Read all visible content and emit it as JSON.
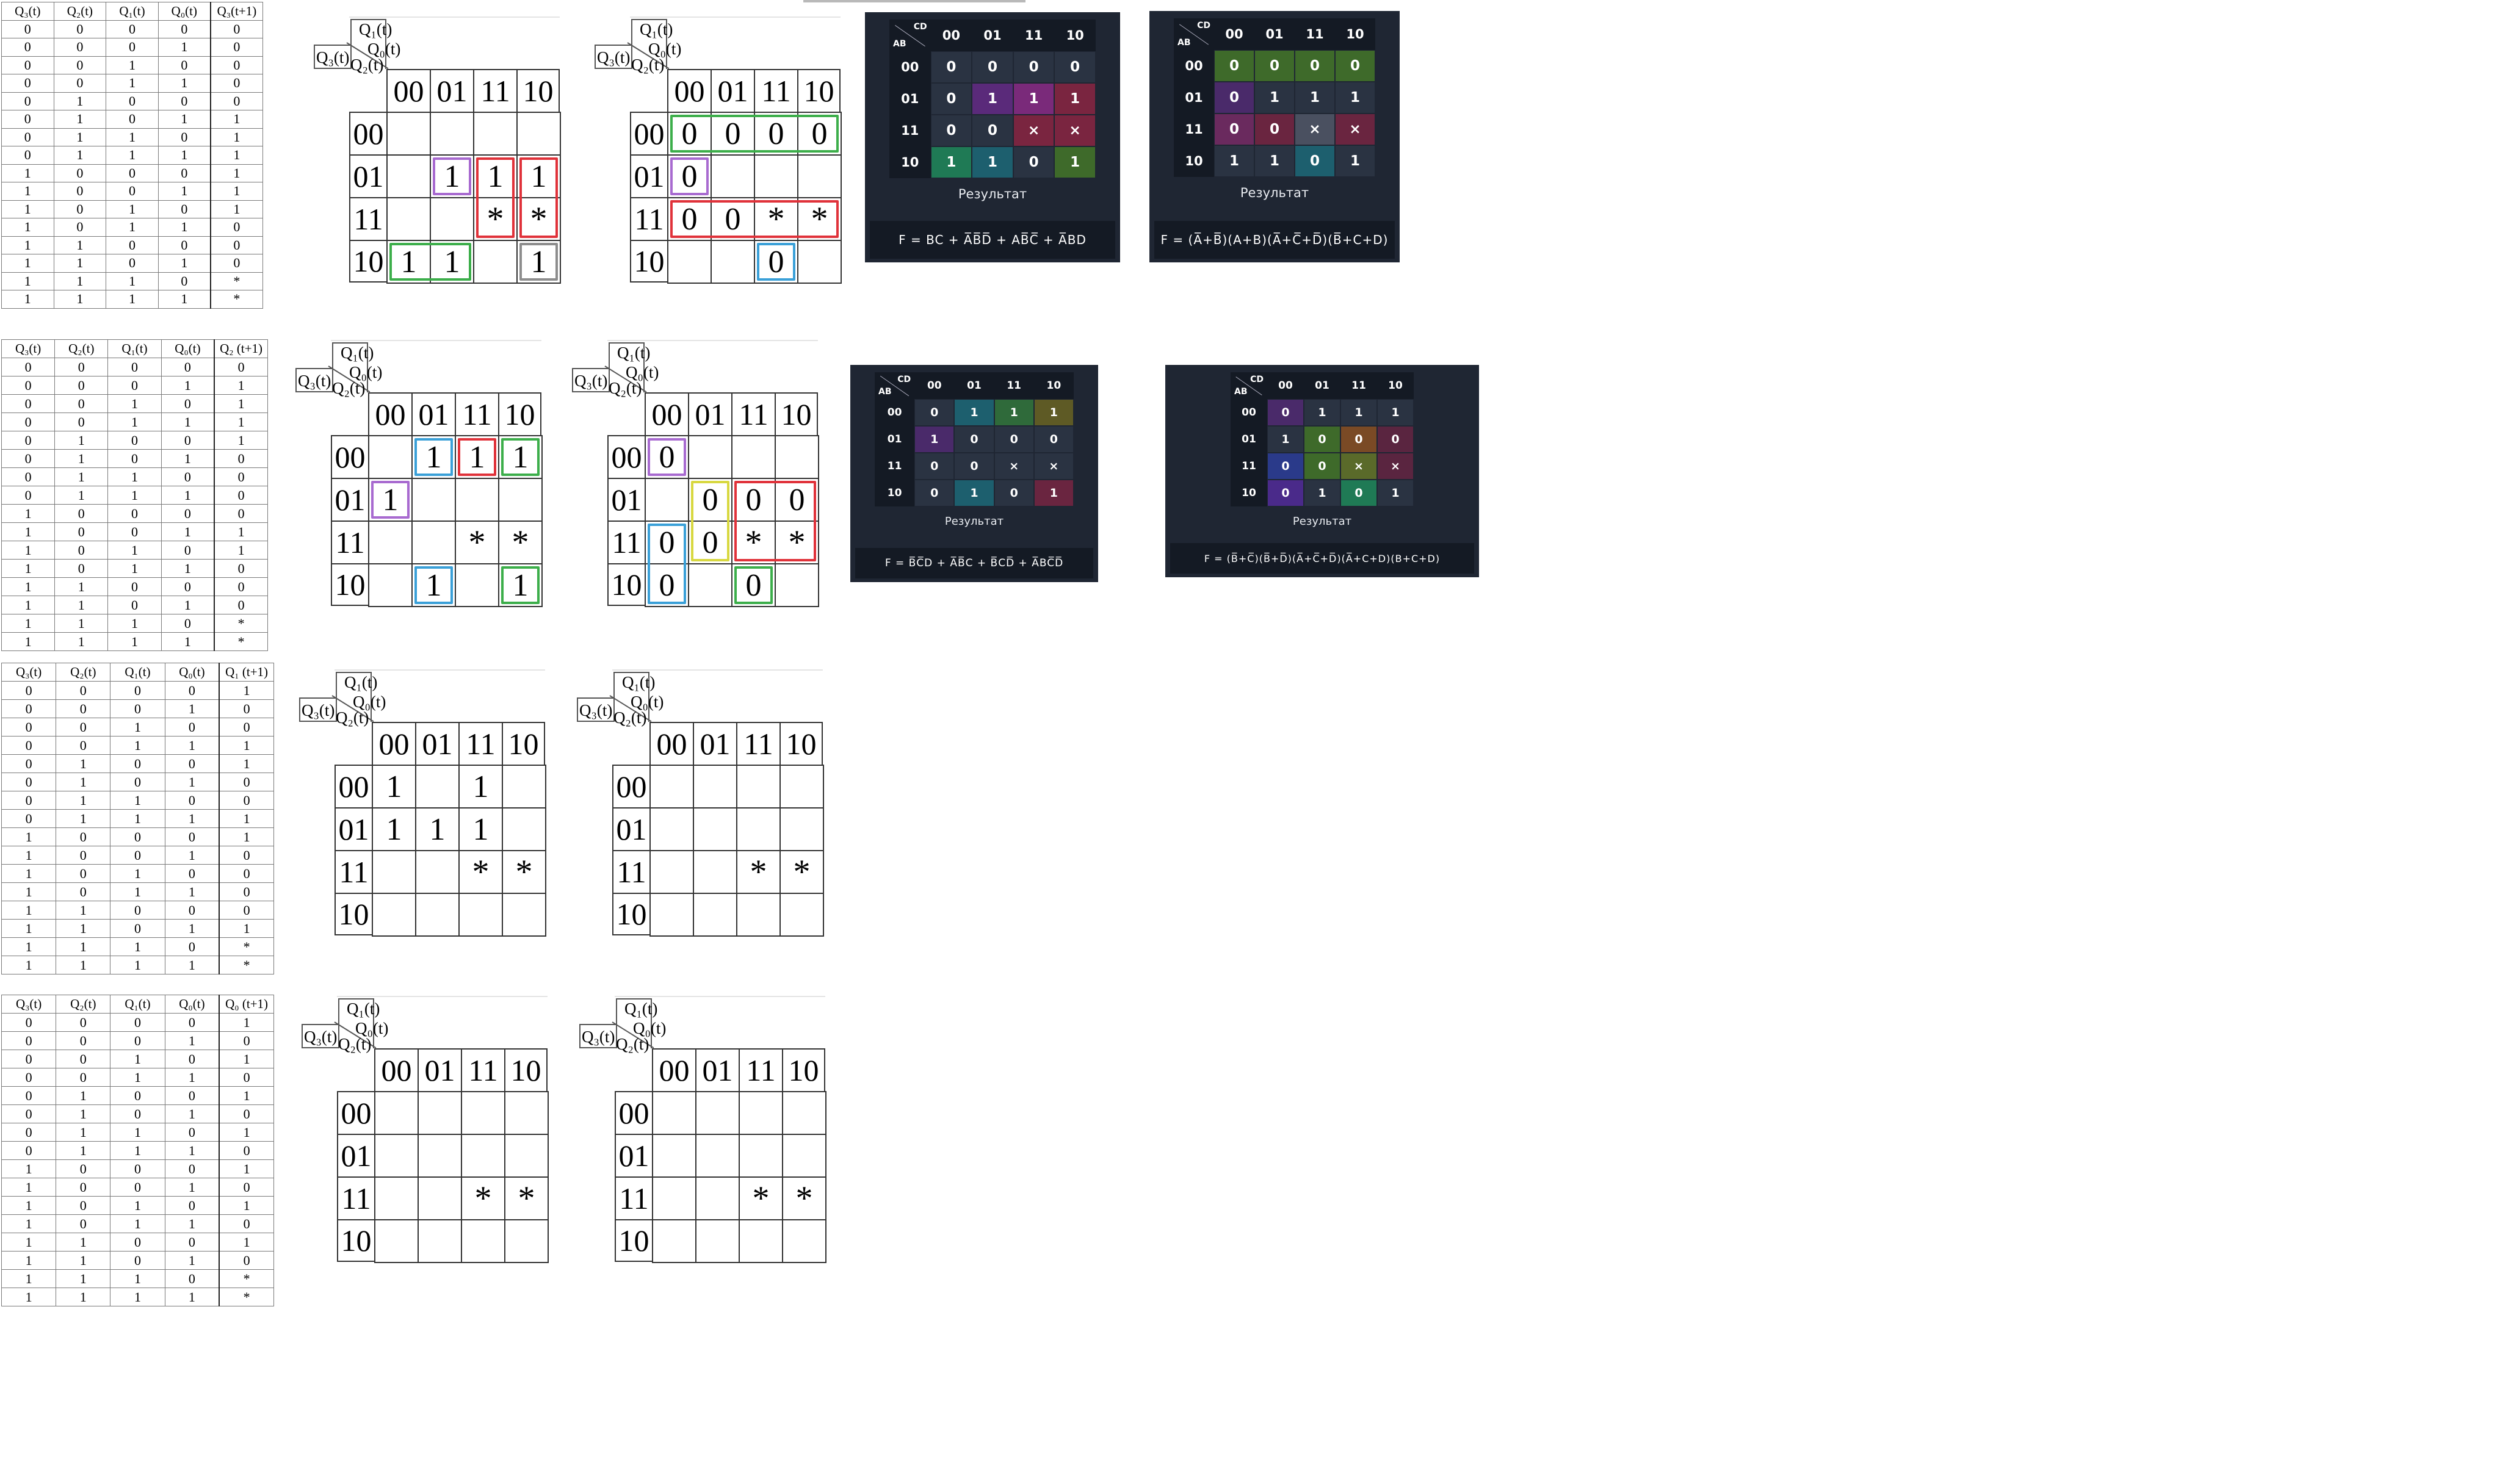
{
  "truth_tables": [
    {
      "headers": [
        "Q₃(t)",
        "Q₂(t)",
        "Q₁(t)",
        "Q₀(t)",
        "Q₃(t+1)"
      ],
      "rows": [
        [
          "0",
          "0",
          "0",
          "0",
          "0"
        ],
        [
          "0",
          "0",
          "0",
          "1",
          "0"
        ],
        [
          "0",
          "0",
          "1",
          "0",
          "0"
        ],
        [
          "0",
          "0",
          "1",
          "1",
          "0"
        ],
        [
          "0",
          "1",
          "0",
          "0",
          "0"
        ],
        [
          "0",
          "1",
          "0",
          "1",
          "1"
        ],
        [
          "0",
          "1",
          "1",
          "0",
          "1"
        ],
        [
          "0",
          "1",
          "1",
          "1",
          "1"
        ],
        [
          "1",
          "0",
          "0",
          "0",
          "1"
        ],
        [
          "1",
          "0",
          "0",
          "1",
          "1"
        ],
        [
          "1",
          "0",
          "1",
          "0",
          "1"
        ],
        [
          "1",
          "0",
          "1",
          "1",
          "0"
        ],
        [
          "1",
          "1",
          "0",
          "0",
          "0"
        ],
        [
          "1",
          "1",
          "0",
          "1",
          "0"
        ],
        [
          "1",
          "1",
          "1",
          "0",
          "*"
        ],
        [
          "1",
          "1",
          "1",
          "1",
          "*"
        ]
      ]
    },
    {
      "headers": [
        "Q₃(t)",
        "Q₂(t)",
        "Q₁(t)",
        "Q₀(t)",
        "Q₂ (t+1)"
      ],
      "rows": [
        [
          "0",
          "0",
          "0",
          "0",
          "0"
        ],
        [
          "0",
          "0",
          "0",
          "1",
          "1"
        ],
        [
          "0",
          "0",
          "1",
          "0",
          "1"
        ],
        [
          "0",
          "0",
          "1",
          "1",
          "1"
        ],
        [
          "0",
          "1",
          "0",
          "0",
          "1"
        ],
        [
          "0",
          "1",
          "0",
          "1",
          "0"
        ],
        [
          "0",
          "1",
          "1",
          "0",
          "0"
        ],
        [
          "0",
          "1",
          "1",
          "1",
          "0"
        ],
        [
          "1",
          "0",
          "0",
          "0",
          "0"
        ],
        [
          "1",
          "0",
          "0",
          "1",
          "1"
        ],
        [
          "1",
          "0",
          "1",
          "0",
          "1"
        ],
        [
          "1",
          "0",
          "1",
          "1",
          "0"
        ],
        [
          "1",
          "1",
          "0",
          "0",
          "0"
        ],
        [
          "1",
          "1",
          "0",
          "1",
          "0"
        ],
        [
          "1",
          "1",
          "1",
          "0",
          "*"
        ],
        [
          "1",
          "1",
          "1",
          "1",
          "*"
        ]
      ]
    },
    {
      "headers": [
        "Q₃(t)",
        "Q₂(t)",
        "Q₁(t)",
        "Q₀(t)",
        "Q₁ (t+1)"
      ],
      "rows": [
        [
          "0",
          "0",
          "0",
          "0",
          "1"
        ],
        [
          "0",
          "0",
          "0",
          "1",
          "0"
        ],
        [
          "0",
          "0",
          "1",
          "0",
          "0"
        ],
        [
          "0",
          "0",
          "1",
          "1",
          "1"
        ],
        [
          "0",
          "1",
          "0",
          "0",
          "1"
        ],
        [
          "0",
          "1",
          "0",
          "1",
          "0"
        ],
        [
          "0",
          "1",
          "1",
          "0",
          "0"
        ],
        [
          "0",
          "1",
          "1",
          "1",
          "1"
        ],
        [
          "1",
          "0",
          "0",
          "0",
          "1"
        ],
        [
          "1",
          "0",
          "0",
          "1",
          "0"
        ],
        [
          "1",
          "0",
          "1",
          "0",
          "0"
        ],
        [
          "1",
          "0",
          "1",
          "1",
          "0"
        ],
        [
          "1",
          "1",
          "0",
          "0",
          "0"
        ],
        [
          "1",
          "1",
          "0",
          "1",
          "1"
        ],
        [
          "1",
          "1",
          "1",
          "0",
          "*"
        ],
        [
          "1",
          "1",
          "1",
          "1",
          "*"
        ]
      ]
    },
    {
      "headers": [
        "Q₃(t)",
        "Q₂(t)",
        "Q₁(t)",
        "Q₀(t)",
        "Q₀ (t+1)"
      ],
      "rows": [
        [
          "0",
          "0",
          "0",
          "0",
          "1"
        ],
        [
          "0",
          "0",
          "0",
          "1",
          "0"
        ],
        [
          "0",
          "0",
          "1",
          "0",
          "1"
        ],
        [
          "0",
          "0",
          "1",
          "1",
          "0"
        ],
        [
          "0",
          "1",
          "0",
          "0",
          "1"
        ],
        [
          "0",
          "1",
          "0",
          "1",
          "0"
        ],
        [
          "0",
          "1",
          "1",
          "0",
          "1"
        ],
        [
          "0",
          "1",
          "1",
          "1",
          "0"
        ],
        [
          "1",
          "0",
          "0",
          "0",
          "1"
        ],
        [
          "1",
          "0",
          "0",
          "1",
          "0"
        ],
        [
          "1",
          "0",
          "1",
          "0",
          "1"
        ],
        [
          "1",
          "0",
          "1",
          "1",
          "0"
        ],
        [
          "1",
          "1",
          "0",
          "0",
          "1"
        ],
        [
          "1",
          "1",
          "0",
          "1",
          "0"
        ],
        [
          "1",
          "1",
          "1",
          "0",
          "*"
        ],
        [
          "1",
          "1",
          "1",
          "1",
          "*"
        ]
      ]
    }
  ],
  "kmap_corner": {
    "top": "Q₁(t)",
    "mid": "Q₀(t)",
    "left": "Q₃(t)",
    "bottom": "Q₂(t)"
  },
  "kmap_headers": [
    "00",
    "01",
    "11",
    "10"
  ],
  "kmaps": [
    {
      "cells": [
        [
          "",
          "",
          "",
          ""
        ],
        [
          "",
          "1",
          "1",
          "1"
        ],
        [
          "",
          "",
          "*",
          "*"
        ],
        [
          "1",
          "1",
          "",
          "1"
        ]
      ]
    },
    {
      "cells": [
        [
          "0",
          "0",
          "0",
          "0"
        ],
        [
          "0",
          "",
          "",
          ""
        ],
        [
          "0",
          "0",
          "*",
          "*"
        ],
        [
          "",
          "",
          "0",
          ""
        ]
      ]
    },
    {
      "cells": [
        [
          "",
          "1",
          "1",
          "1"
        ],
        [
          "1",
          "",
          "",
          ""
        ],
        [
          "",
          "",
          "*",
          "*"
        ],
        [
          "",
          "1",
          "",
          "1"
        ]
      ]
    },
    {
      "cells": [
        [
          "0",
          "",
          "",
          ""
        ],
        [
          "",
          "0",
          "0",
          "0"
        ],
        [
          "0",
          "0",
          "*",
          "*"
        ],
        [
          "0",
          "",
          "0",
          ""
        ]
      ]
    },
    {
      "cells": [
        [
          "1",
          "",
          "1",
          ""
        ],
        [
          "1",
          "1",
          "1",
          ""
        ],
        [
          "",
          "",
          "*",
          "*"
        ],
        [
          "",
          "",
          "",
          ""
        ]
      ]
    },
    {
      "cells": [
        [
          "",
          "",
          "",
          ""
        ],
        [
          "",
          "",
          "",
          ""
        ],
        [
          "",
          "",
          "*",
          "*"
        ],
        [
          "",
          "",
          "",
          ""
        ]
      ]
    },
    {
      "cells": [
        [
          "",
          "",
          "",
          ""
        ],
        [
          "",
          "",
          "",
          ""
        ],
        [
          "",
          "",
          "*",
          "*"
        ],
        [
          "",
          "",
          "",
          ""
        ]
      ]
    },
    {
      "cells": [
        [
          "",
          "",
          "",
          ""
        ],
        [
          "",
          "",
          "",
          ""
        ],
        [
          "",
          "",
          "*",
          "*"
        ],
        [
          "",
          "",
          "",
          ""
        ]
      ]
    }
  ],
  "dark_panels": [
    {
      "corner_top": "CD",
      "corner_left": "AB",
      "headers": [
        "00",
        "01",
        "11",
        "10"
      ],
      "cells": [
        [
          "0",
          "0",
          "0",
          "0"
        ],
        [
          "0",
          "1",
          "1",
          "1"
        ],
        [
          "0",
          "0",
          "×",
          "×"
        ],
        [
          "1",
          "1",
          "0",
          "1"
        ]
      ],
      "colors": [
        [
          "",
          "",
          "",
          ""
        ],
        [
          "",
          "#5a2a7a",
          "#7a2a7a",
          "#7a2540"
        ],
        [
          "",
          "",
          "#7a2540",
          "#7a2540"
        ],
        [
          "#1f7a55",
          "#1d5f6e",
          "",
          "#3e6a2a"
        ]
      ],
      "result_label": "Результат",
      "formula": "F = BC + A̅B̅D̅ + AB̅C̅ + A̅BD"
    },
    {
      "corner_top": "CD",
      "corner_left": "AB",
      "headers": [
        "00",
        "01",
        "11",
        "10"
      ],
      "cells": [
        [
          "0",
          "0",
          "0",
          "0"
        ],
        [
          "0",
          "1",
          "1",
          "1"
        ],
        [
          "0",
          "0",
          "×",
          "×"
        ],
        [
          "1",
          "1",
          "0",
          "1"
        ]
      ],
      "colors": [
        [
          "#3e6a2a",
          "#3e6a2a",
          "#3e6a2a",
          "#3e6a2a"
        ],
        [
          "#4a2a6a",
          "",
          "",
          ""
        ],
        [
          "#6a2a5e",
          "#6a2540",
          "#4a5060",
          "#6a2540"
        ],
        [
          "",
          "",
          "#1d5f6e",
          ""
        ]
      ],
      "result_label": "Результат",
      "formula": "F = (A̅+B̅)(A+B)(A̅+C̅+D̅)(B̅+C+D)"
    },
    {
      "corner_top": "CD",
      "corner_left": "AB",
      "headers": [
        "00",
        "01",
        "11",
        "10"
      ],
      "cells": [
        [
          "0",
          "1",
          "1",
          "1"
        ],
        [
          "1",
          "0",
          "0",
          "0"
        ],
        [
          "0",
          "0",
          "×",
          "×"
        ],
        [
          "0",
          "1",
          "0",
          "1"
        ]
      ],
      "colors": [
        [
          "",
          "#1d5f6e",
          "#2f6a3a",
          "#5e5a25"
        ],
        [
          "#4a2a6a",
          "",
          "",
          ""
        ],
        [
          "",
          "",
          "",
          ""
        ],
        [
          "",
          "#1d5f6e",
          "",
          "#6a2540"
        ]
      ],
      "result_label": "Результат",
      "formula": "F = B̅C̅D + A̅B̅C + B̅CD̅ + A̅BC̅D̅"
    },
    {
      "corner_top": "CD",
      "corner_left": "AB",
      "headers": [
        "00",
        "01",
        "11",
        "10"
      ],
      "cells": [
        [
          "0",
          "1",
          "1",
          "1"
        ],
        [
          "1",
          "0",
          "0",
          "0"
        ],
        [
          "0",
          "0",
          "×",
          "×"
        ],
        [
          "0",
          "1",
          "0",
          "1"
        ]
      ],
      "colors": [
        [
          "#4a2a6a",
          "",
          "",
          ""
        ],
        [
          "",
          "#3e6a2a",
          "#7a4a25",
          "#5a2540"
        ],
        [
          "#2a3a8a",
          "#3e6a2a",
          "#5a6a2a",
          "#5a2540"
        ],
        [
          "#4a2a8a",
          "",
          "#1f7a55",
          ""
        ]
      ],
      "result_label": "Результат",
      "formula": "F = (B̅+C̅)(B̅+D̅)(A̅+C̅+D̅)(A̅+C+D)(B+C+D)"
    }
  ]
}
